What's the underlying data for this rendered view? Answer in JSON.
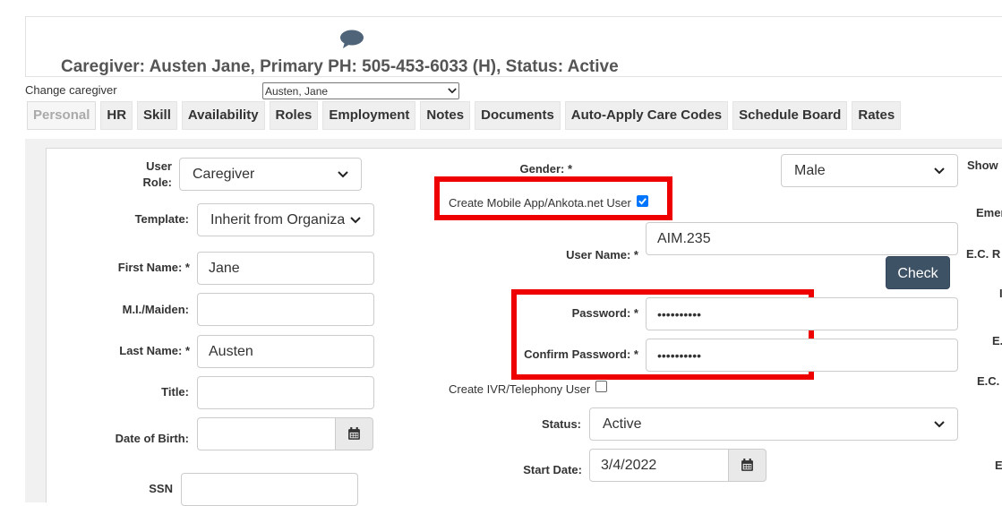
{
  "header": {
    "title": "Caregiver: Austen Jane, Primary PH: 505-453-6033 (H), Status: Active",
    "change_caregiver_label": "Change caregiver",
    "caregiver_selected": "Austen, Jane"
  },
  "tabs": [
    {
      "label": "Personal",
      "active": true
    },
    {
      "label": "HR"
    },
    {
      "label": "Skill"
    },
    {
      "label": "Availability"
    },
    {
      "label": "Roles"
    },
    {
      "label": "Employment"
    },
    {
      "label": "Notes"
    },
    {
      "label": "Documents"
    },
    {
      "label": "Auto-Apply Care Codes"
    },
    {
      "label": "Schedule Board"
    },
    {
      "label": "Rates"
    }
  ],
  "form": {
    "user_role_label": "User Role:",
    "user_role_value": "Caregiver",
    "template_label": "Template:",
    "template_value": "Inherit from Organizat",
    "first_name_label": "First Name: *",
    "first_name_value": "Jane",
    "mi_label": "M.I./Maiden:",
    "mi_value": "",
    "last_name_label": "Last Name: *",
    "last_name_value": "Austen",
    "title_label": "Title:",
    "title_value": "",
    "dob_label": "Date of Birth:",
    "dob_value": "",
    "ssn_label": "SSN",
    "ssn_value": "",
    "gender_label": "Gender: *",
    "gender_value": "Male",
    "create_mobile_label": "Create Mobile App/Ankota.net User",
    "create_mobile_checked": true,
    "username_label": "User Name: *",
    "username_value": "AIM.235",
    "check_button": "Check",
    "password_label": "Password: *",
    "password_value": "••••••••••",
    "confirm_password_label": "Confirm Password: *",
    "confirm_password_value": "••••••••••",
    "create_ivr_label": "Create IVR/Telephony User",
    "create_ivr_checked": false,
    "status_label": "Status:",
    "status_value": "Active",
    "start_date_label": "Start Date:",
    "start_date_value": "3/4/2022"
  },
  "right_cutoff_labels": [
    "Show I",
    "Emer",
    "E.C. R",
    "I",
    "E.",
    "E.C.",
    "E"
  ],
  "colors": {
    "highlight_red": "#ee0000",
    "check_button_bg": "#3e5265",
    "icon_slate": "#4f6479",
    "checkbox_blue": "#0075ff"
  }
}
